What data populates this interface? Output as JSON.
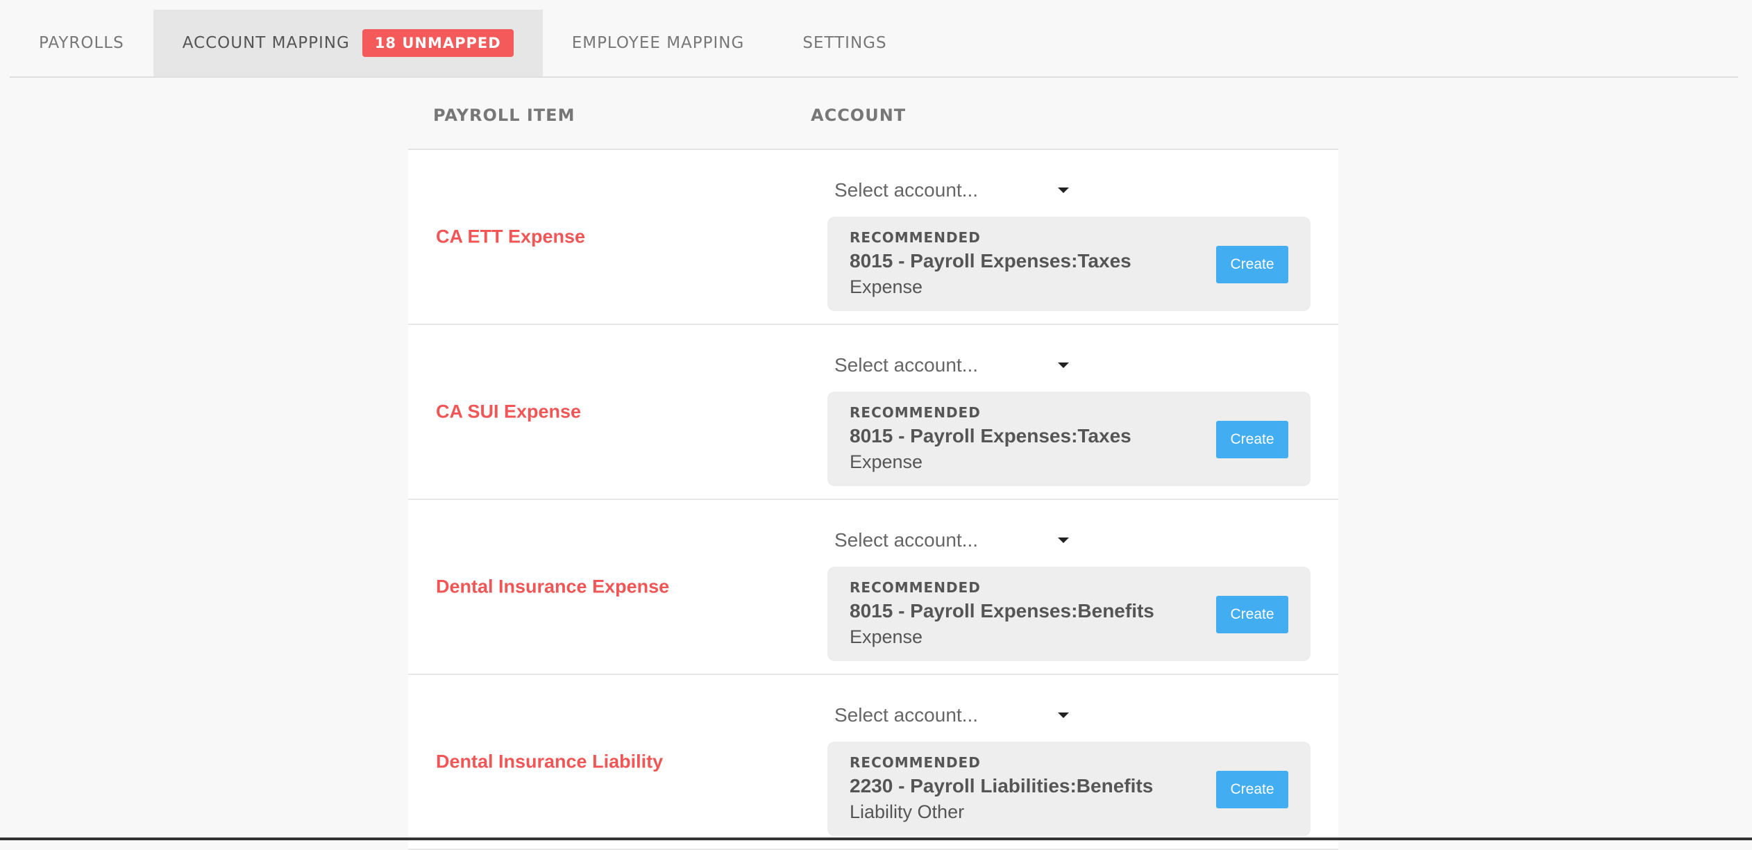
{
  "tabs": [
    {
      "label": "PAYROLLS"
    },
    {
      "label": "ACCOUNT MAPPING",
      "badge": "18 UNMAPPED"
    },
    {
      "label": "EMPLOYEE MAPPING"
    },
    {
      "label": "SETTINGS"
    }
  ],
  "active_tab": "ACCOUNT MAPPING",
  "table": {
    "headers": {
      "item": "PAYROLL ITEM",
      "account": "ACCOUNT"
    },
    "rows": [
      {
        "item": "CA ETT Expense",
        "select_placeholder": "Select account...",
        "rec_label": "RECOMMENDED",
        "rec_account": "8015 - Payroll Expenses:Taxes",
        "rec_type": "Expense",
        "button": "Create"
      },
      {
        "item": "CA SUI Expense",
        "select_placeholder": "Select account...",
        "rec_label": "RECOMMENDED",
        "rec_account": "8015 - Payroll Expenses:Taxes",
        "rec_type": "Expense",
        "button": "Create"
      },
      {
        "item": "Dental Insurance Expense",
        "select_placeholder": "Select account...",
        "rec_label": "RECOMMENDED",
        "rec_account": "8015 - Payroll Expenses:Benefits",
        "rec_type": "Expense",
        "button": "Create"
      },
      {
        "item": "Dental Insurance Liability",
        "select_placeholder": "Select account...",
        "rec_label": "RECOMMENDED",
        "rec_account": "2230 - Payroll Liabilities:Benefits",
        "rec_type": "Liability Other",
        "button": "Create"
      }
    ]
  },
  "colors": {
    "accent_red": "#f25555",
    "button_blue": "#42adf1",
    "active_tab_bg": "#e6e6e6"
  }
}
